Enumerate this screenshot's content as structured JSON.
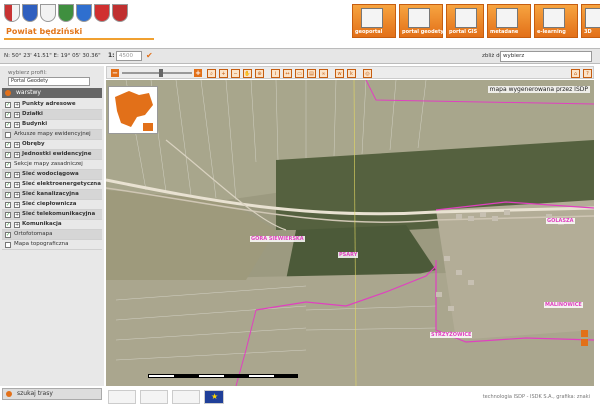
{
  "header": {
    "site_title": "Powiat będziński",
    "portals": [
      {
        "label": "geoportal"
      },
      {
        "label": "portal geodety"
      },
      {
        "label": "portal GIS"
      },
      {
        "label": "metadane"
      },
      {
        "label": "e-learning"
      },
      {
        "label": "3D"
      }
    ]
  },
  "coordbar": {
    "coords": "N: 50° 23' 41.51\" E: 19° 05' 30.36\"",
    "scale_prefix": "1:",
    "scale_value": "4500",
    "zoom_label": "zbliż do:",
    "zoom_value": "wybierz"
  },
  "sidebar": {
    "profile_label": "wybierz profil:",
    "profile_value": "Portal Geodety",
    "layers_title": "warstwy",
    "layers": [
      {
        "name": "Punkty adresowe",
        "checked": true,
        "expandable": true
      },
      {
        "name": "Działki",
        "checked": true,
        "expandable": true
      },
      {
        "name": "Budynki",
        "checked": true,
        "expandable": true
      },
      {
        "name": "Arkusze mapy ewidencyjnej",
        "checked": false,
        "expandable": false
      },
      {
        "name": "Obręby",
        "checked": true,
        "expandable": true
      },
      {
        "name": "Jednostki ewidencyjne",
        "checked": true,
        "expandable": true
      },
      {
        "name": "Sekcje mapy zasadniczej",
        "checked": true,
        "expandable": false
      },
      {
        "name": "Sieć wodociągowa",
        "checked": true,
        "expandable": true
      },
      {
        "name": "Sieć elektroenergetyczna",
        "checked": true,
        "expandable": true
      },
      {
        "name": "Sieć kanalizacyjna",
        "checked": true,
        "expandable": true
      },
      {
        "name": "Sieć ciepłownicza",
        "checked": true,
        "expandable": true
      },
      {
        "name": "Sieć telekomunikacyjna",
        "checked": true,
        "expandable": true
      },
      {
        "name": "Komunikacja",
        "checked": true,
        "expandable": true
      },
      {
        "name": "Ortofotomapa",
        "checked": true,
        "expandable": false
      },
      {
        "name": "Mapa topograficzna",
        "checked": false,
        "expandable": false
      }
    ],
    "search_label": "szukaj trasy"
  },
  "map": {
    "title": "mapa wygenerowana przez ISDP",
    "place_labels": [
      "GÓRA SIEWIERSKA",
      "PSARY",
      "GOLASZA",
      "MALINOWICE",
      "STRZYŻOWICE"
    ]
  },
  "footer": {
    "credits": "technologia ISDP - ISDK S.A., grafika: znaki"
  },
  "colors": {
    "accent": "#e27019",
    "boundary": "#e040c0"
  }
}
